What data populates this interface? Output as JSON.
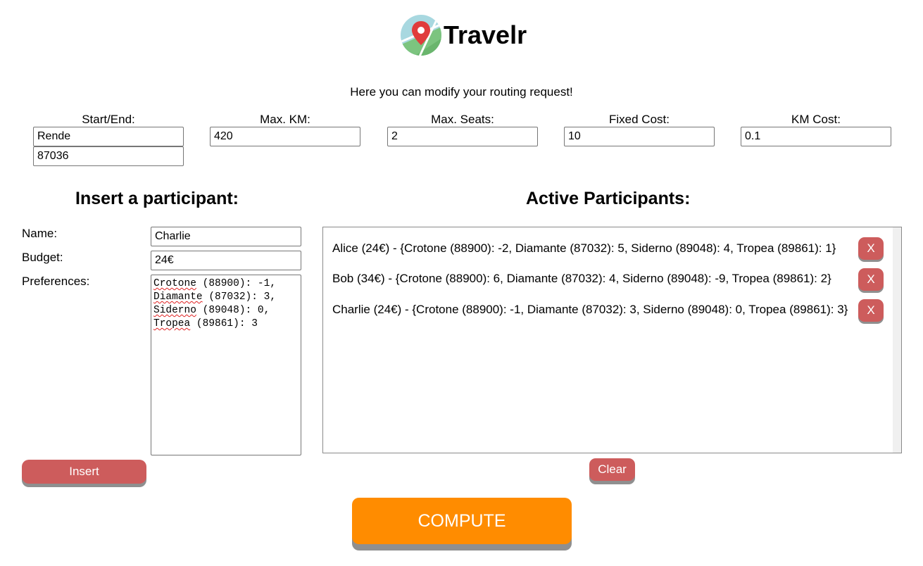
{
  "header": {
    "logo_icon": "map-pin-icon",
    "title": "Travelr"
  },
  "subtitle": "Here you can modify your routing request!",
  "request": {
    "start_end": {
      "label": "Start/End:",
      "city": "Rende",
      "zip": "87036"
    },
    "max_km": {
      "label": "Max. KM:",
      "value": "420"
    },
    "max_seats": {
      "label": "Max. Seats:",
      "value": "2"
    },
    "fixed_cost": {
      "label": "Fixed Cost:",
      "value": "10"
    },
    "km_cost": {
      "label": "KM Cost:",
      "value": "0.1"
    }
  },
  "insert_form": {
    "title": "Insert a participant:",
    "name_label": "Name:",
    "name_value": "Charlie",
    "budget_label": "Budget:",
    "budget_value": "24€",
    "preferences_label": "Preferences:",
    "preferences_lines": [
      {
        "city": "Crotone",
        "rest": " (88900): -1,"
      },
      {
        "city": "Diamante",
        "rest": " (87032): 3,"
      },
      {
        "city": "Siderno",
        "rest": " (89048): 0,"
      },
      {
        "city": "Tropea",
        "rest": " (89861): 3"
      }
    ],
    "insert_label": "Insert"
  },
  "active": {
    "title": "Active Participants:",
    "participants": [
      {
        "text": "Alice (24€) - {Crotone (88900): -2, Diamante (87032): 5, Siderno (89048): 4, Tropea (89861): 1}",
        "remove_label": "X"
      },
      {
        "text": "Bob (34€) - {Crotone (88900): 6, Diamante (87032): 4, Siderno (89048): -9, Tropea (89861): 2}",
        "remove_label": "X"
      },
      {
        "text": "Charlie (24€) - {Crotone (88900): -1, Diamante (87032): 3, Siderno (89048): 0, Tropea (89861): 3}",
        "remove_label": "X"
      }
    ],
    "clear_label": "Clear"
  },
  "compute_label": "COMPUTE",
  "colors": {
    "danger": "#cd5c5c",
    "primary": "#ff8c00",
    "shadow": "#8f8f8f"
  }
}
